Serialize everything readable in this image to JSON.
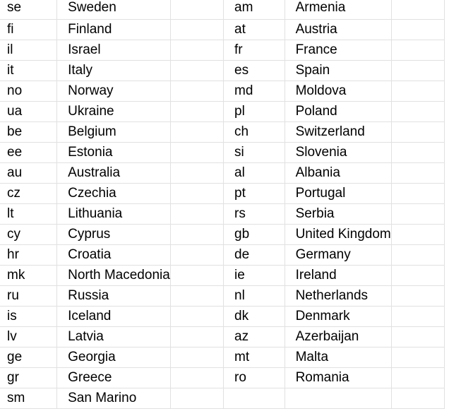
{
  "sheet": {
    "rows": [
      [
        "se",
        "Sweden",
        "",
        "am",
        "Armenia",
        ""
      ],
      [
        "fi",
        "Finland",
        "",
        "at",
        "Austria",
        ""
      ],
      [
        "il",
        "Israel",
        "",
        "fr",
        "France",
        ""
      ],
      [
        "it",
        "Italy",
        "",
        "es",
        "Spain",
        ""
      ],
      [
        "no",
        "Norway",
        "",
        "md",
        "Moldova",
        ""
      ],
      [
        "ua",
        "Ukraine",
        "",
        "pl",
        "Poland",
        ""
      ],
      [
        "be",
        "Belgium",
        "",
        "ch",
        "Switzerland",
        ""
      ],
      [
        "ee",
        "Estonia",
        "",
        "si",
        "Slovenia",
        ""
      ],
      [
        "au",
        "Australia",
        "",
        "al",
        "Albania",
        ""
      ],
      [
        "cz",
        "Czechia",
        "",
        "pt",
        "Portugal",
        ""
      ],
      [
        "lt",
        "Lithuania",
        "",
        "rs",
        "Serbia",
        ""
      ],
      [
        "cy",
        "Cyprus",
        "",
        "gb",
        "United Kingdom",
        ""
      ],
      [
        "hr",
        "Croatia",
        "",
        "de",
        "Germany",
        ""
      ],
      [
        "mk",
        "North Macedonia",
        "",
        "ie",
        "Ireland",
        ""
      ],
      [
        "ru",
        "Russia",
        "",
        "nl",
        "Netherlands",
        ""
      ],
      [
        "is",
        "Iceland",
        "",
        "dk",
        "Denmark",
        ""
      ],
      [
        "lv",
        "Latvia",
        "",
        "az",
        "Azerbaijan",
        ""
      ],
      [
        "ge",
        "Georgia",
        "",
        "mt",
        "Malta",
        ""
      ],
      [
        "gr",
        "Greece",
        "",
        "ro",
        "Romania",
        ""
      ],
      [
        "sm",
        "San Marino",
        "",
        "",
        "",
        ""
      ]
    ]
  }
}
